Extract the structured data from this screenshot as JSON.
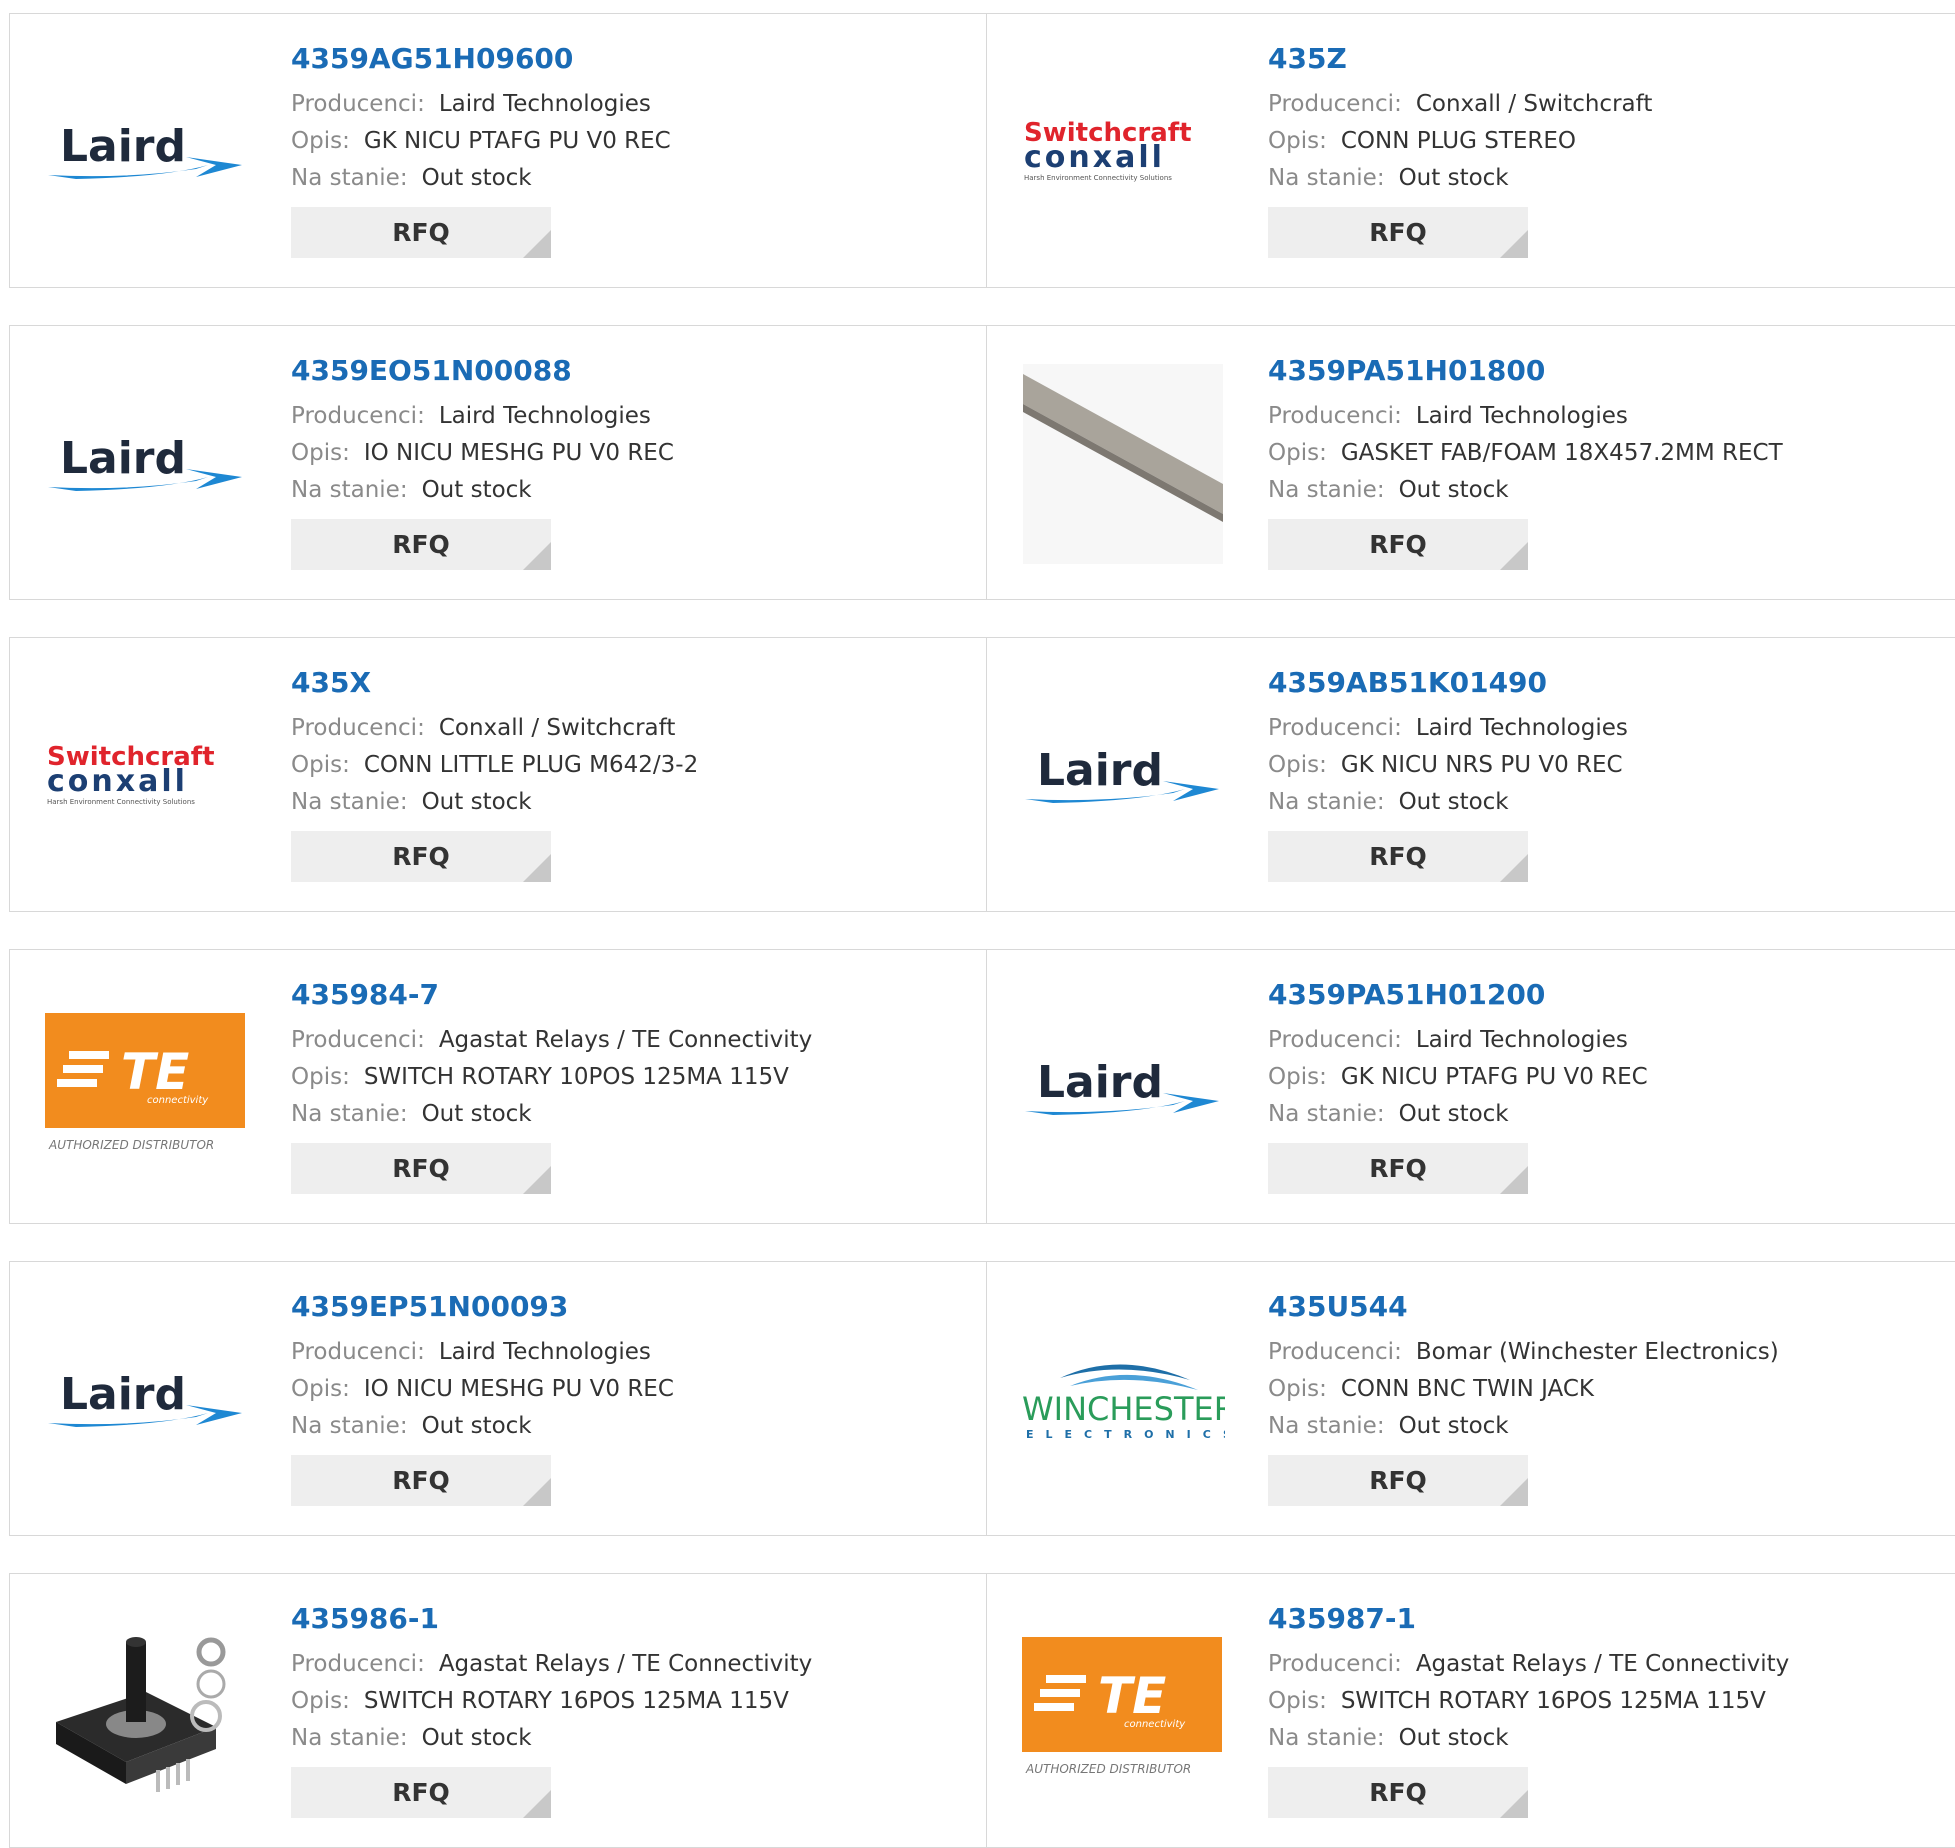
{
  "labels": {
    "manufacturer": "Producenci:",
    "description": "Opis:",
    "stock": "Na stanie:",
    "rfq": "RFQ"
  },
  "brand_text": {
    "laird": "Laird",
    "switchcraft": "Switchcraft",
    "conxall": "conxall",
    "conxall_tagline": "Harsh Environment Connectivity Solutions",
    "te": "TE",
    "te_sub": "connectivity",
    "te_authorized": "AUTHORIZED DISTRIBUTOR",
    "winchester": "WINCHESTER",
    "winchester_sub": "ELECTRONICS"
  },
  "colors": {
    "link_blue": "#1a6bb5",
    "te_orange": "#f28c1e",
    "laird_blue": "#1e88d3",
    "switchcraft_red": "#e0242c",
    "conxall_navy": "#1c3f73",
    "winchester_green": "#2a9c5a"
  },
  "products": [
    {
      "part": "4359AG51H09600",
      "manufacturer": "Laird Technologies",
      "description": "GK NICU PTAFG PU V0 REC",
      "stock": "Out stock",
      "image": "laird-logo"
    },
    {
      "part": "435Z",
      "manufacturer": "Conxall / Switchcraft",
      "description": "CONN PLUG STEREO",
      "stock": "Out stock",
      "image": "switchcraft-conxall-logo"
    },
    {
      "part": "4359EO51N00088",
      "manufacturer": "Laird Technologies",
      "description": "IO NICU MESHG PU V0 REC",
      "stock": "Out stock",
      "image": "laird-logo"
    },
    {
      "part": "4359PA51H01800",
      "manufacturer": "Laird Technologies",
      "description": "GASKET FAB/FOAM 18X457.2MM RECT",
      "stock": "Out stock",
      "image": "gasket-strip-photo"
    },
    {
      "part": "435X",
      "manufacturer": "Conxall / Switchcraft",
      "description": "CONN LITTLE PLUG M642/3-2",
      "stock": "Out stock",
      "image": "switchcraft-conxall-logo"
    },
    {
      "part": "4359AB51K01490",
      "manufacturer": "Laird Technologies",
      "description": "GK NICU NRS PU V0 REC",
      "stock": "Out stock",
      "image": "laird-logo"
    },
    {
      "part": "435984-7",
      "manufacturer": "Agastat Relays / TE Connectivity",
      "description": "SWITCH ROTARY 10POS 125MA 115V",
      "stock": "Out stock",
      "image": "te-logo"
    },
    {
      "part": "4359PA51H01200",
      "manufacturer": "Laird Technologies",
      "description": "GK NICU PTAFG PU V0 REC",
      "stock": "Out stock",
      "image": "laird-logo"
    },
    {
      "part": "4359EP51N00093",
      "manufacturer": "Laird Technologies",
      "description": "IO NICU MESHG PU V0 REC",
      "stock": "Out stock",
      "image": "laird-logo"
    },
    {
      "part": "435U544",
      "manufacturer": "Bomar (Winchester Electronics)",
      "description": "CONN BNC TWIN JACK",
      "stock": "Out stock",
      "image": "winchester-logo"
    },
    {
      "part": "435986-1",
      "manufacturer": "Agastat Relays / TE Connectivity",
      "description": "SWITCH ROTARY 16POS 125MA 115V",
      "stock": "Out stock",
      "image": "rotary-switch-photo"
    },
    {
      "part": "435987-1",
      "manufacturer": "Agastat Relays / TE Connectivity",
      "description": "SWITCH ROTARY 16POS 125MA 115V",
      "stock": "Out stock",
      "image": "te-logo"
    }
  ]
}
